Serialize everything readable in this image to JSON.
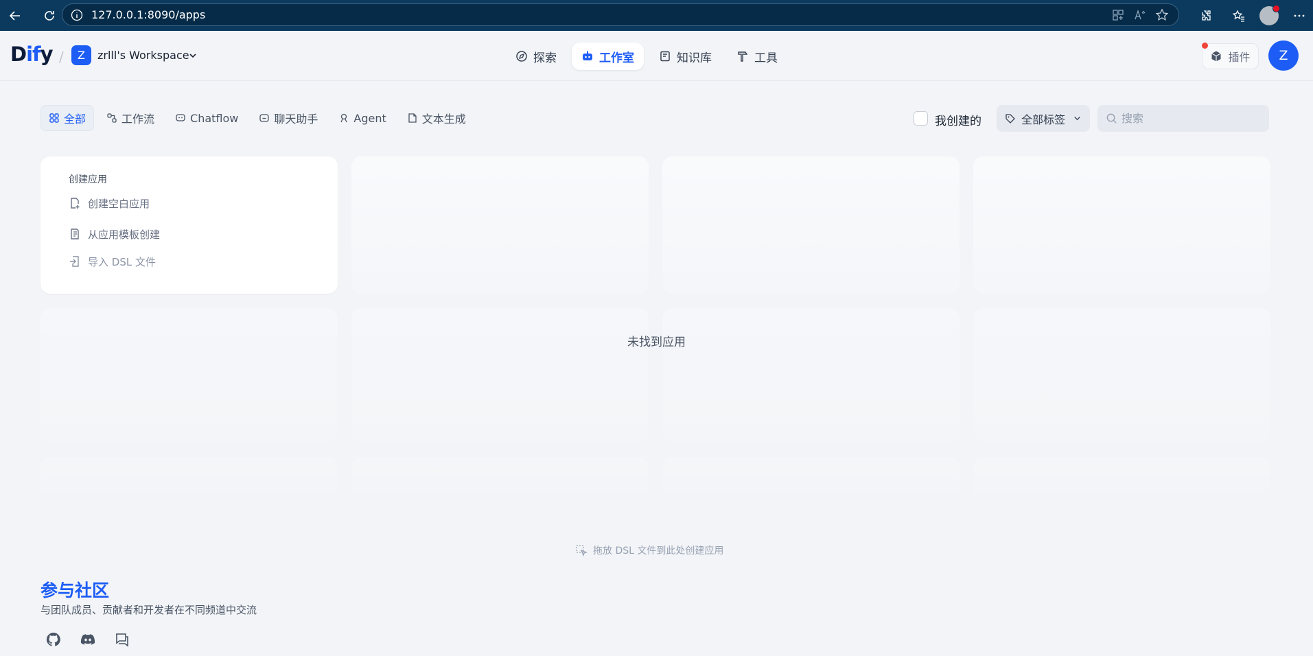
{
  "browser": {
    "url": "127.0.0.1:8090/apps"
  },
  "header": {
    "logo_main": "D",
    "logo_accent": "if",
    "logo_tail": "y",
    "workspace_initial": "Z",
    "workspace_name": "zrlll's Workspace",
    "nav": [
      {
        "label": "探索",
        "icon": "compass-icon"
      },
      {
        "label": "工作室",
        "icon": "robot-icon",
        "active": true
      },
      {
        "label": "知识库",
        "icon": "book-icon"
      },
      {
        "label": "工具",
        "icon": "hammer-icon"
      }
    ],
    "plugin_label": "插件",
    "user_initial": "Z"
  },
  "filters": {
    "tabs": [
      {
        "label": "全部",
        "icon": "grid-icon",
        "active": true
      },
      {
        "label": "工作流",
        "icon": "workflow-icon"
      },
      {
        "label": "Chatflow",
        "icon": "chatflow-icon"
      },
      {
        "label": "聊天助手",
        "icon": "chat-bot-icon"
      },
      {
        "label": "Agent",
        "icon": "agent-icon"
      },
      {
        "label": "文本生成",
        "icon": "document-icon"
      }
    ],
    "mine_label": "我创建的",
    "tag_filter_label": "全部标签",
    "search_placeholder": "搜索"
  },
  "create_card": {
    "title": "创建应用",
    "items": [
      {
        "label": "创建空白应用",
        "icon": "new-file-icon"
      },
      {
        "label": "从应用模板创建",
        "icon": "template-icon"
      },
      {
        "label": "导入 DSL 文件",
        "icon": "import-icon"
      }
    ]
  },
  "empty_message": "未找到应用",
  "drop_hint": "拖放 DSL 文件到此处创建应用",
  "community": {
    "title": "参与社区",
    "description": "与团队成员、贡献者和开发者在不同频道中交流",
    "links": [
      {
        "icon": "github-icon"
      },
      {
        "icon": "discord-icon"
      },
      {
        "icon": "forum-icon"
      }
    ]
  },
  "colors": {
    "accent": "#1d5df5",
    "background": "#f2f4f7",
    "browser_bar": "#0b3a5e"
  }
}
